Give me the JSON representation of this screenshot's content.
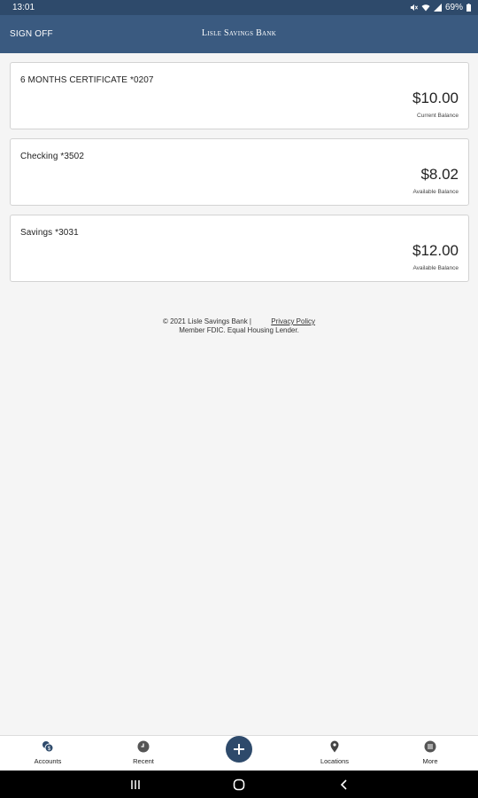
{
  "status_bar": {
    "time": "13:01",
    "battery": "69%"
  },
  "header": {
    "sign_off_label": "SIGN OFF",
    "title": "Lisle Savings Bank"
  },
  "accounts": [
    {
      "name": "6 MONTHS CERTIFICATE *0207",
      "balance": "$10.00",
      "balance_label": "Current Balance"
    },
    {
      "name": "Checking *3502",
      "balance": "$8.02",
      "balance_label": "Available Balance"
    },
    {
      "name": "Savings *3031",
      "balance": "$12.00",
      "balance_label": "Available Balance"
    }
  ],
  "footer": {
    "copyright": "© 2021 Lisle Savings Bank |",
    "privacy_link": "Privacy Policy",
    "member_text": "Member FDIC. Equal Housing Lender."
  },
  "tab_bar": {
    "tabs": [
      {
        "label": "Accounts",
        "icon": "accounts-icon"
      },
      {
        "label": "Recent",
        "icon": "clock-icon"
      },
      {
        "label": "Locations",
        "icon": "location-pin-icon"
      },
      {
        "label": "More",
        "icon": "more-icon"
      }
    ],
    "fab_icon": "plus-icon"
  },
  "colors": {
    "header": "#3a5a80",
    "status_bar": "#2e4a6b",
    "accent": "#2e4a6b"
  }
}
